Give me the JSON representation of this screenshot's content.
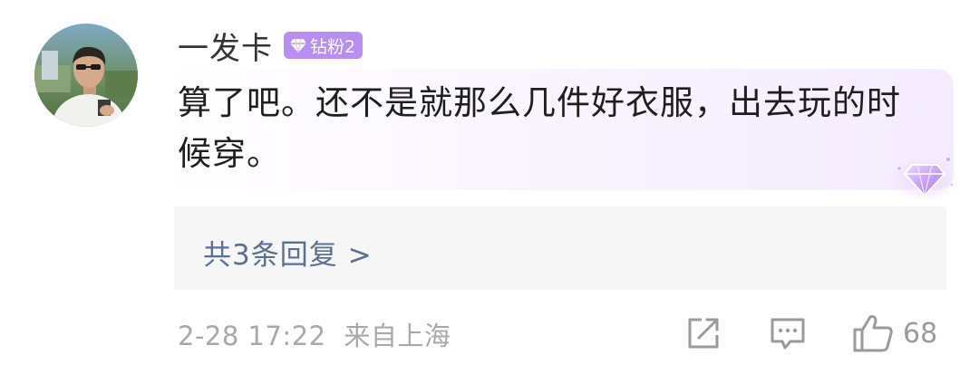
{
  "comment": {
    "username": "一发卡",
    "badge_label": "钻粉2",
    "text": "算了吧。还不是就那么几件好衣服，出去玩的时候穿。",
    "replies_link": "共3条回复 >",
    "timestamp": "2-28 17:22",
    "location": "来自上海",
    "like_count": "68"
  },
  "icons": {
    "badge": "diamond-icon",
    "decoration": "diamond-badge-icon",
    "share": "share-icon",
    "reply": "comment-icon",
    "like": "thumbs-up-icon"
  },
  "colors": {
    "badge_bg": "#b98ef2",
    "replies_link": "#5a7090",
    "meta_text": "#a8a8a8"
  }
}
